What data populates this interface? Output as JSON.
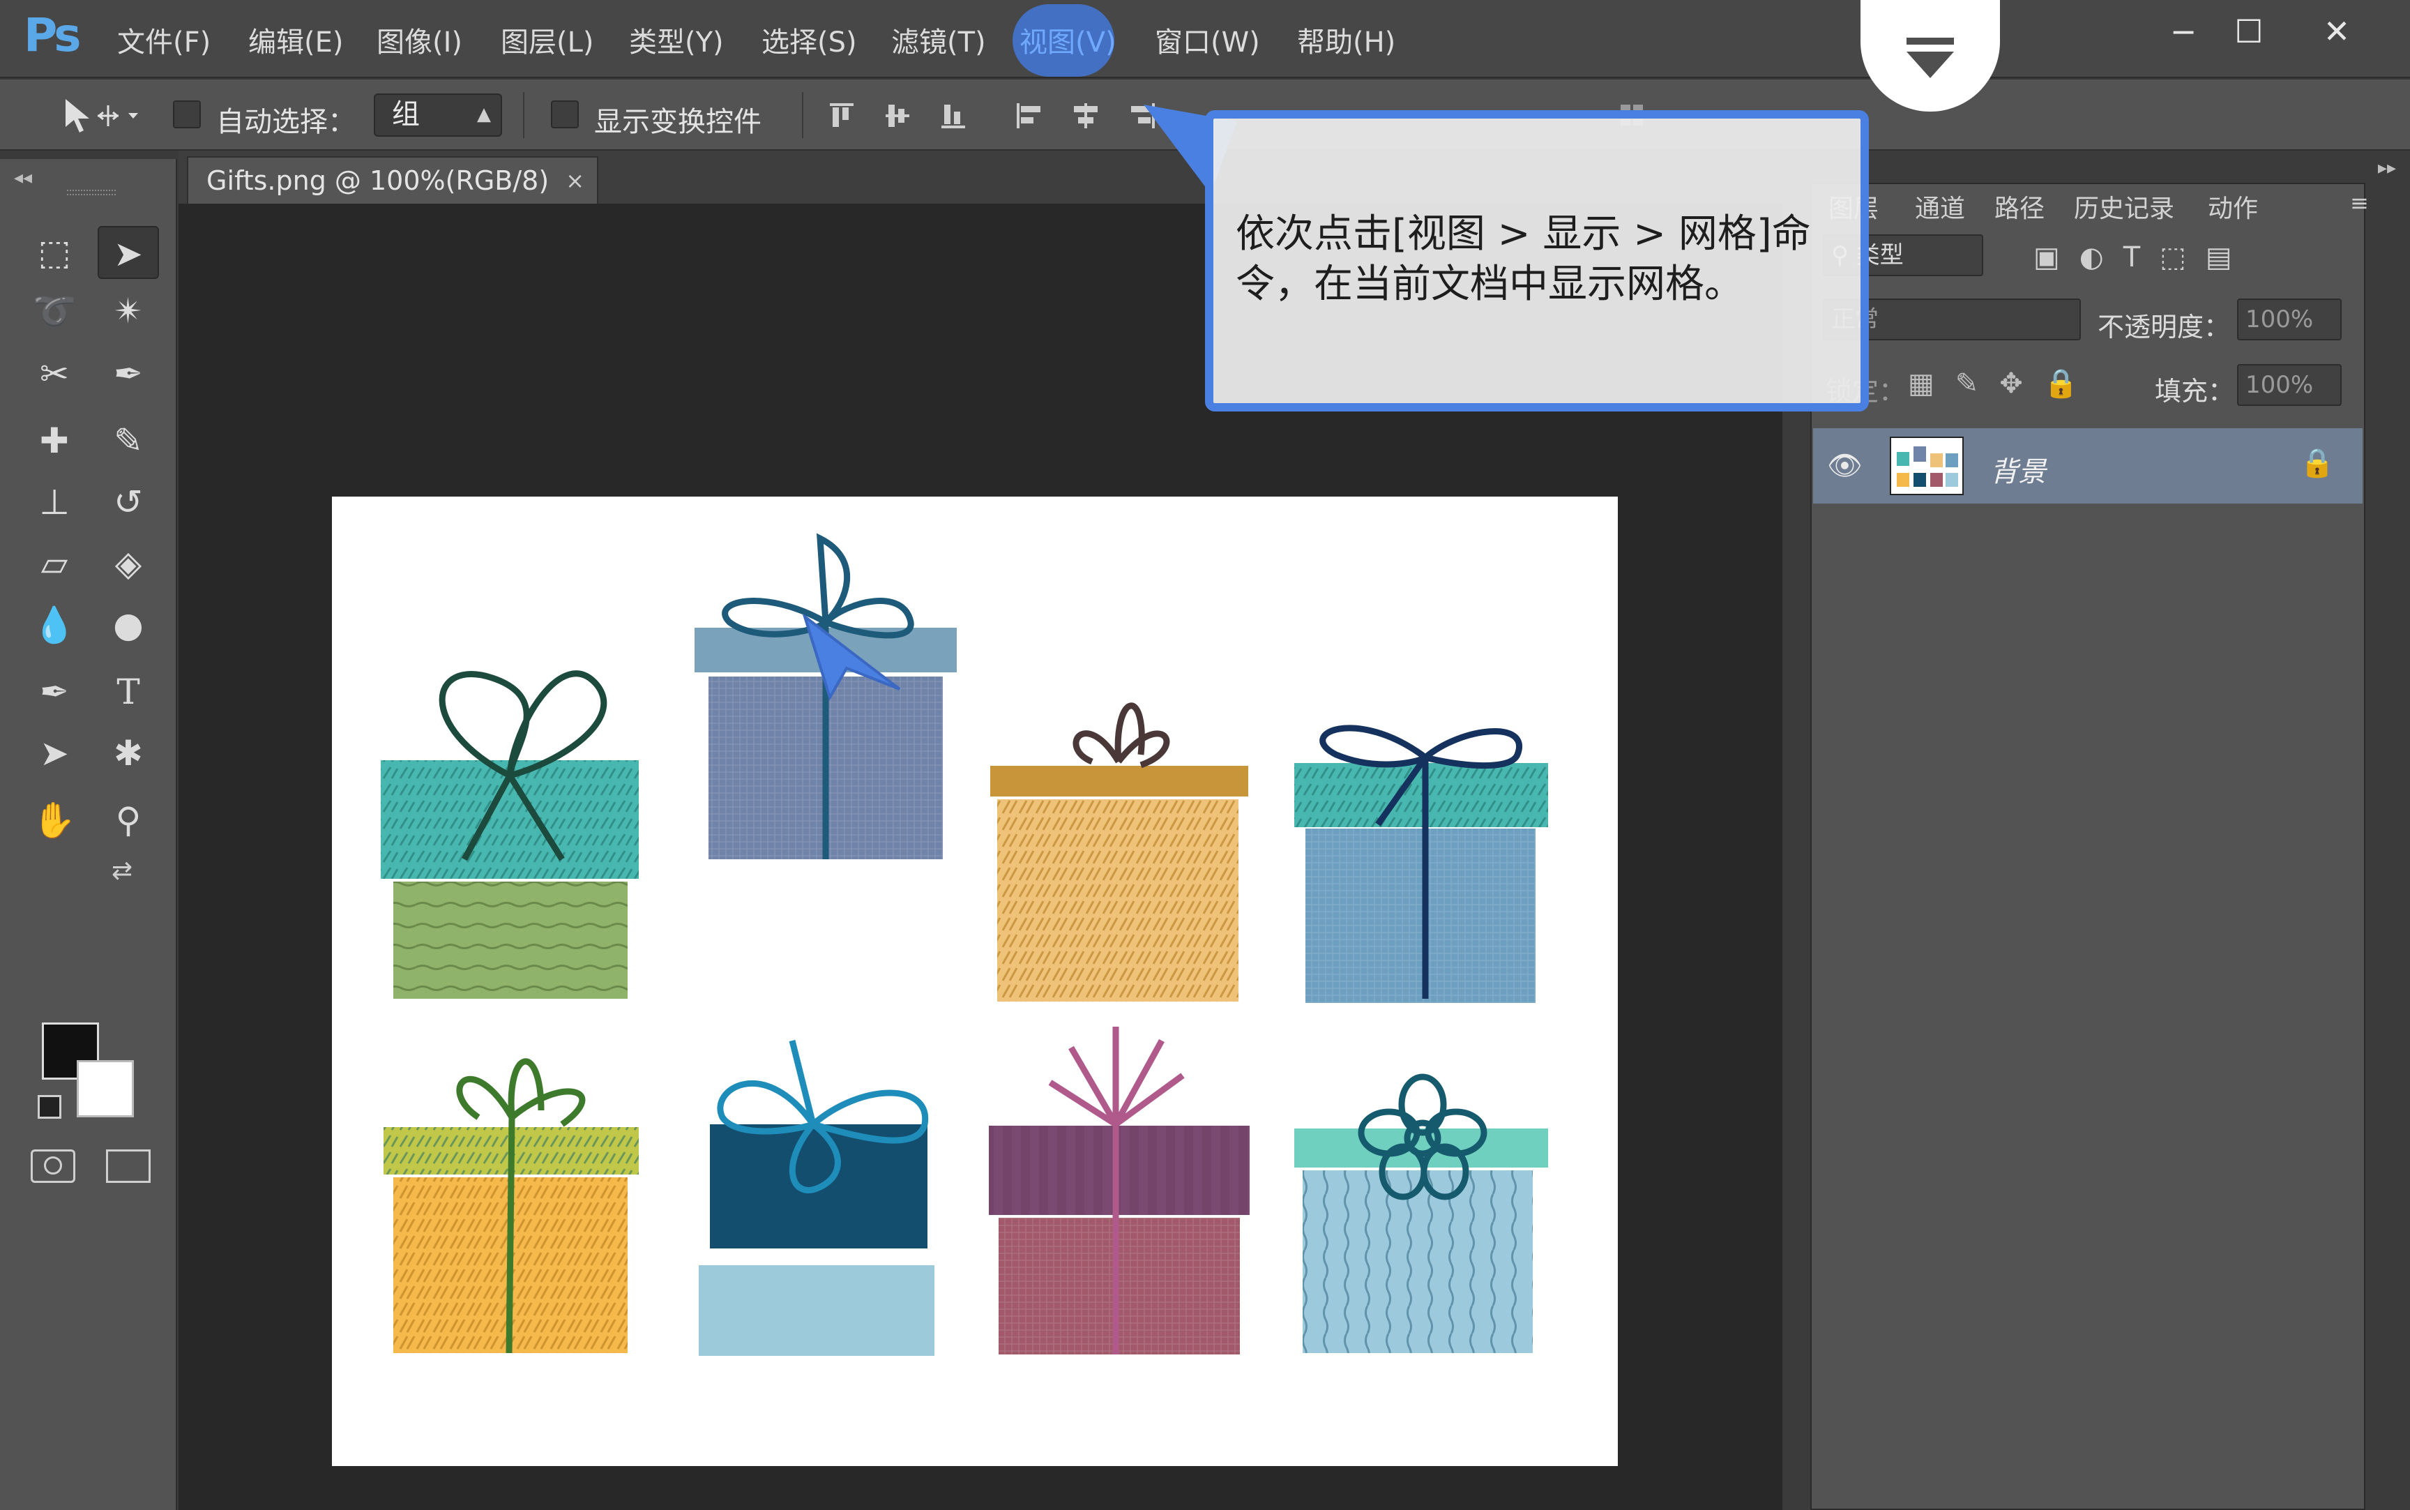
{
  "app": {
    "logo": "Ps"
  },
  "menu": {
    "items": [
      "文件(F)",
      "编辑(E)",
      "图像(I)",
      "图层(L)",
      "类型(Y)",
      "选择(S)",
      "滤镜(T)",
      "视图(V)",
      "窗口(W)",
      "帮助(H)"
    ],
    "active": "视图(V)"
  },
  "window_controls": {
    "minimize": "−",
    "maximize": "☐",
    "close": "✕"
  },
  "options_bar": {
    "auto_select_label": "自动选择：",
    "auto_select_value": "组",
    "show_transform_label": "显示变换控件"
  },
  "document": {
    "tab_title": "Gifts.png @ 100%(RGB/8)",
    "tab_close": "×"
  },
  "layers_panel": {
    "tabs": [
      "图层",
      "通道",
      "路径",
      "历史记录",
      "动作"
    ],
    "filter_kind": "类型",
    "blend_mode": "正常",
    "opacity_label": "不透明度：",
    "opacity_value": "100%",
    "lock_label": "锁定：",
    "fill_label": "填充：",
    "fill_value": "100%",
    "layer_name": "背景"
  },
  "callout": {
    "text": "依次点击[视图 > 显示 > 网格]命令，在当前文档中显示网格。"
  },
  "colors": {
    "accent": "#4a80e2",
    "foreground": "#111111",
    "background": "#ffffff"
  }
}
